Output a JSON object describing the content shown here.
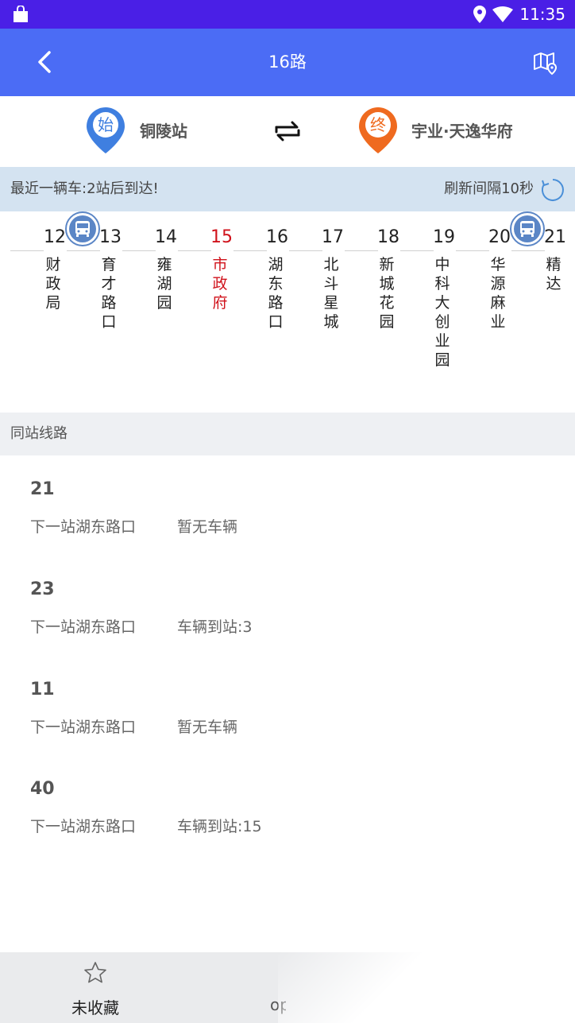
{
  "status_bar": {
    "time": "11:35"
  },
  "app_bar": {
    "title": "16路"
  },
  "route": {
    "start_badge": "始",
    "start_station": "铜陵站",
    "end_badge": "终",
    "end_station": "宇业·天逸华府"
  },
  "info": {
    "nearest_bus": "最近一辆车:2站后到达!",
    "refresh_interval": "刷新间隔10秒"
  },
  "stops": [
    {
      "num": "12",
      "name": "财政局"
    },
    {
      "num": "13",
      "name": "育才路口"
    },
    {
      "num": "14",
      "name": "雍湖园"
    },
    {
      "num": "15",
      "name": "市政府",
      "current": true
    },
    {
      "num": "16",
      "name": "湖东路口"
    },
    {
      "num": "17",
      "name": "北斗星城"
    },
    {
      "num": "18",
      "name": "新城花园"
    },
    {
      "num": "19",
      "name": "中科大创业园"
    },
    {
      "num": "20",
      "name": "华源麻业"
    },
    {
      "num": "21",
      "name": "精达"
    }
  ],
  "section": {
    "title": "同站线路"
  },
  "lines": [
    {
      "num": "21",
      "next": "下一站湖东路口",
      "status": "暂无车辆"
    },
    {
      "num": "23",
      "next": "下一站湖东路口",
      "status": "车辆到站:3"
    },
    {
      "num": "11",
      "next": "下一站湖东路口",
      "status": "暂无车辆"
    },
    {
      "num": "40",
      "next": "下一站湖东路口",
      "status": "车辆到站:15"
    }
  ],
  "bottom_bar": {
    "favorite_label": "未收藏",
    "other_label": "op"
  },
  "colors": {
    "status_bar": "#4a1fe6",
    "app_bar": "#4b6cf5",
    "current_stop": "#d0121b",
    "start_pin": "#3f7fe0",
    "end_pin": "#ef6a1f"
  }
}
